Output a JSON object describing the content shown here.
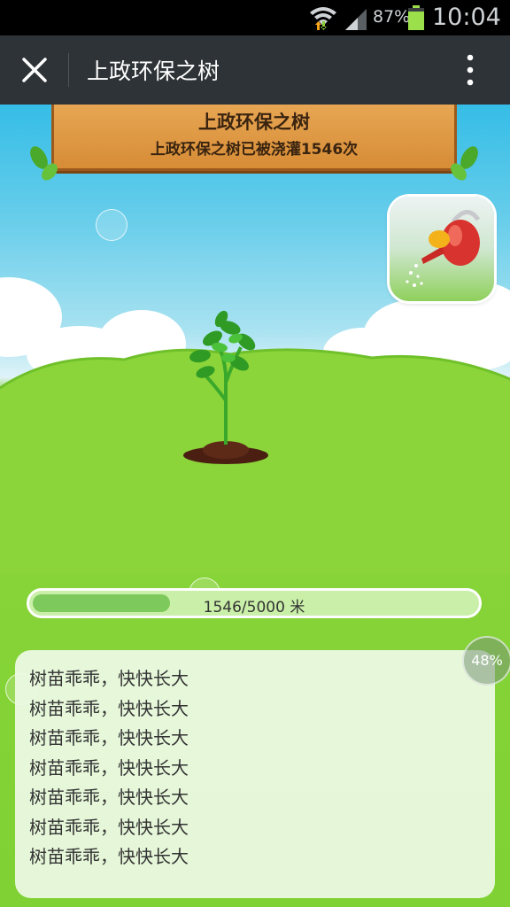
{
  "status_bar": {
    "battery_pct": "87%",
    "time": "10:04"
  },
  "title_bar": {
    "title": "上政环保之树"
  },
  "sign": {
    "title": "上政环保之树",
    "subtitle": "上政环保之树已被浇灌1546次"
  },
  "progress": {
    "text": "1546/5000 米",
    "fraction": 0.3092
  },
  "messages": [
    "树苗乖乖，快快长大",
    "树苗乖乖，快快长大",
    "树苗乖乖，快快长大",
    "树苗乖乖，快快长大",
    "树苗乖乖，快快长大",
    "树苗乖乖，快快长大",
    "树苗乖乖，快快长大"
  ],
  "float_button": {
    "label": "48%"
  },
  "colors": {
    "titlebar": "#2e3337",
    "grass": "#7fd134",
    "sky": "#35bde7",
    "progress_fill": "#7ec95b",
    "sign_wood": "#d78c36"
  },
  "icons": [
    "wifi-icon",
    "signal-icon",
    "battery-icon",
    "close-icon",
    "more-vert-icon",
    "watering-can-icon"
  ]
}
